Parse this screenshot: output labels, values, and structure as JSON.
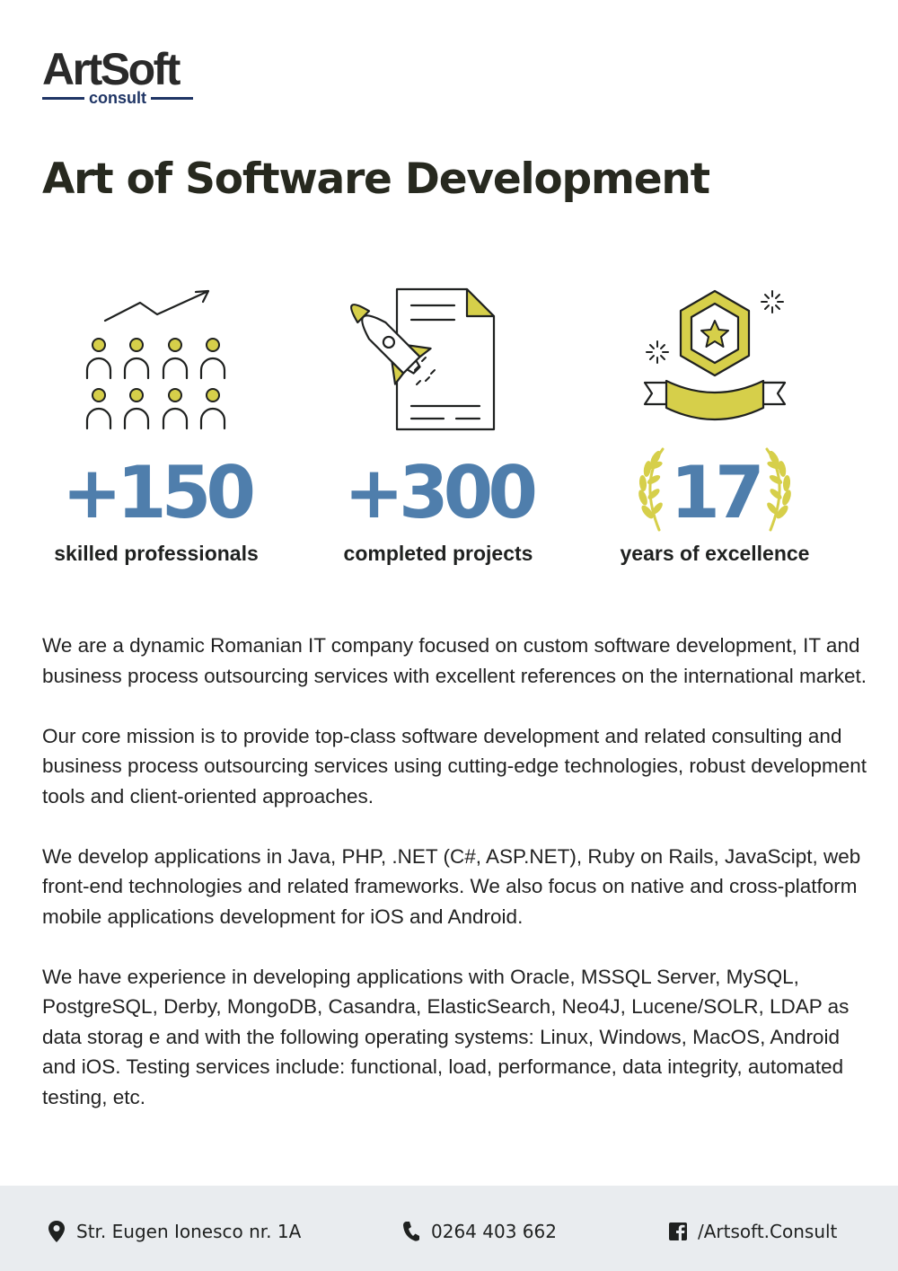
{
  "logo": {
    "main": "ArtSoft",
    "sub": "consult"
  },
  "headline": "Art of Software Development",
  "stats": [
    {
      "number": "+150",
      "label": "skilled professionals",
      "icon": "team-growth-icon"
    },
    {
      "number": "+300",
      "label": "completed projects",
      "icon": "rocket-document-icon"
    },
    {
      "number": "17",
      "label": "years of excellence",
      "icon": "star-badge-icon"
    }
  ],
  "paragraphs": [
    "We are a dynamic Romanian IT company focused on custom software development, IT and business process outsourcing services with excellent references on the international market.",
    "Our core mission is to provide top-class software development and related consulting and business process outsourcing services using cutting-edge technologies, robust development tools and client-oriented approaches.",
    "We develop applications in Java, PHP, .NET (C#, ASP.NET), Ruby on Rails, JavaScipt, web front-end technologies and related frameworks. We also focus on native and cross-platform mobile applications development for iOS and Android.",
    "We have experience in developing applications with Oracle, MSSQL Server, MySQL, PostgreSQL, Derby, MongoDB, Casandra, ElasticSearch, Neo4J, Lucene/SOLR, LDAP as data storag e and with the following operating systems: Linux, Windows, MacOS, Android and iOS. Testing services include: functional, load, performance, data integrity, automated testing, etc."
  ],
  "footer": {
    "address": "Str. Eugen Ionesco nr. 1A",
    "phone": "0264 403 662",
    "social": "/Artsoft.Consult"
  },
  "colors": {
    "accent_blue": "#4f7eac",
    "accent_yellow": "#d6cf4a",
    "logo_navy": "#1f3565",
    "footer_bg": "#e9ecef"
  }
}
